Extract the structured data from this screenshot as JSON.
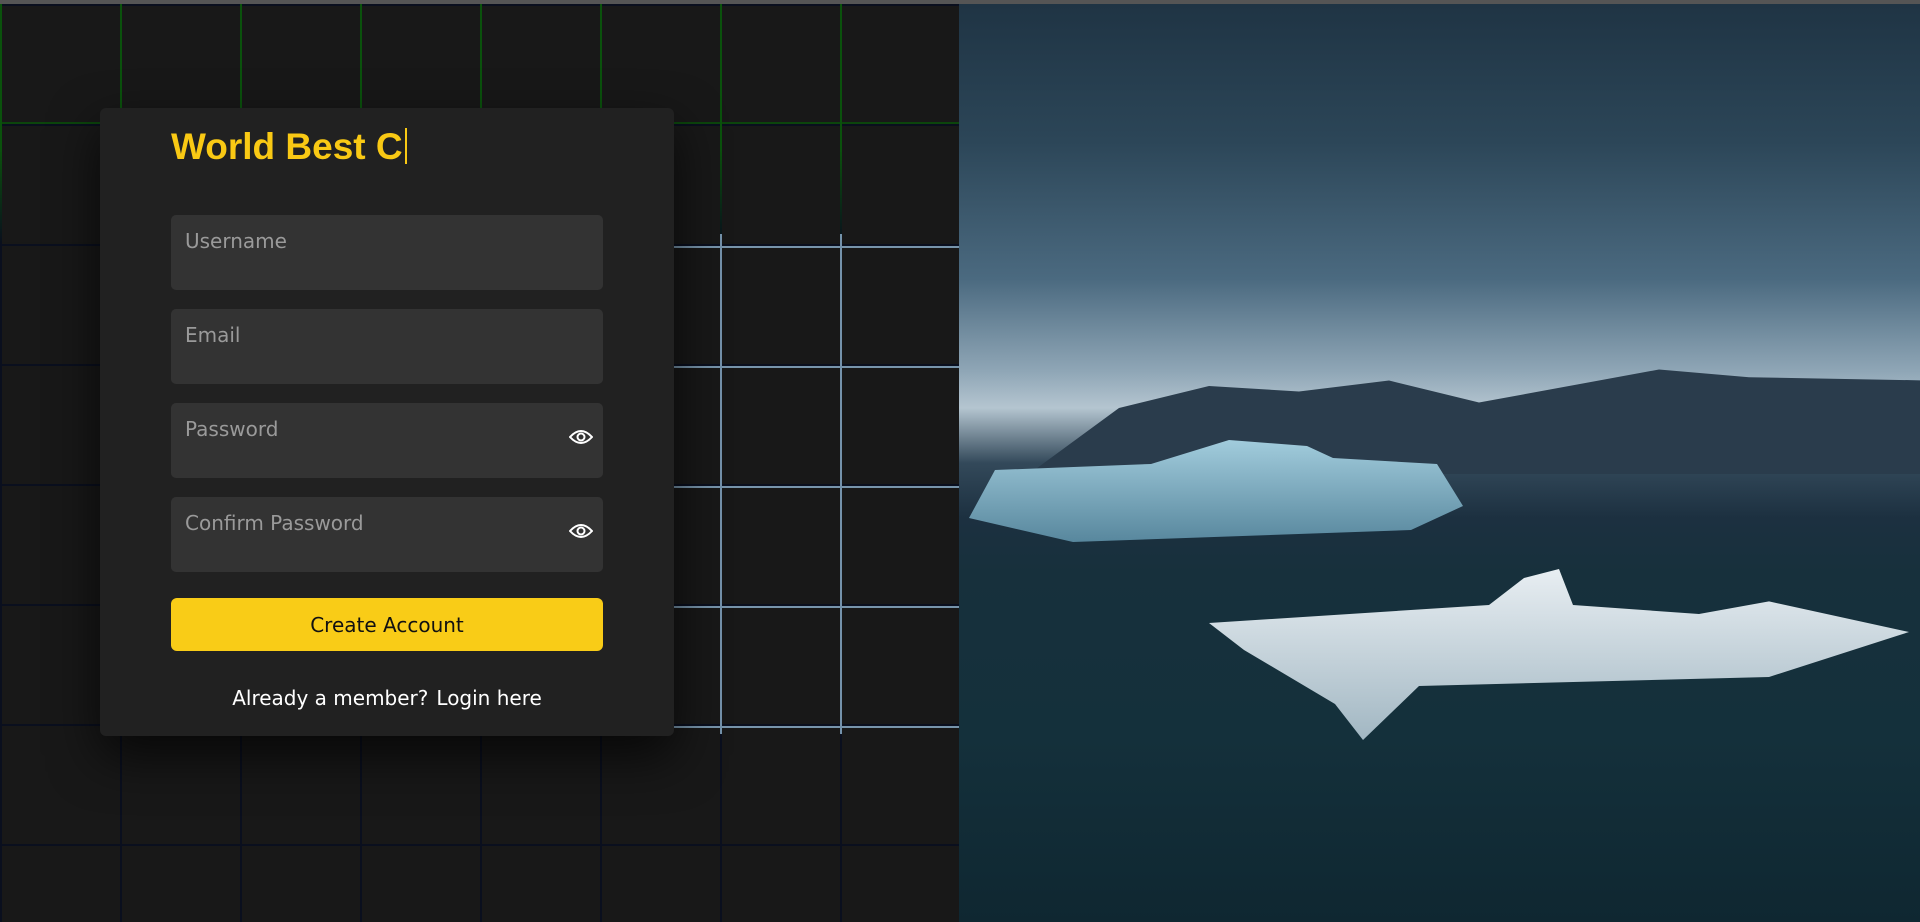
{
  "brand": {
    "title": "World Best C"
  },
  "form": {
    "username_placeholder": "Username",
    "email_placeholder": "Email",
    "password_placeholder": "Password",
    "confirm_placeholder": "Confirm Password",
    "submit_label": "Create Account",
    "footer_text": "Already a member?",
    "login_link": "Login here"
  },
  "colors": {
    "accent": "#f9cc17",
    "card": "#212121",
    "field": "#333333"
  }
}
